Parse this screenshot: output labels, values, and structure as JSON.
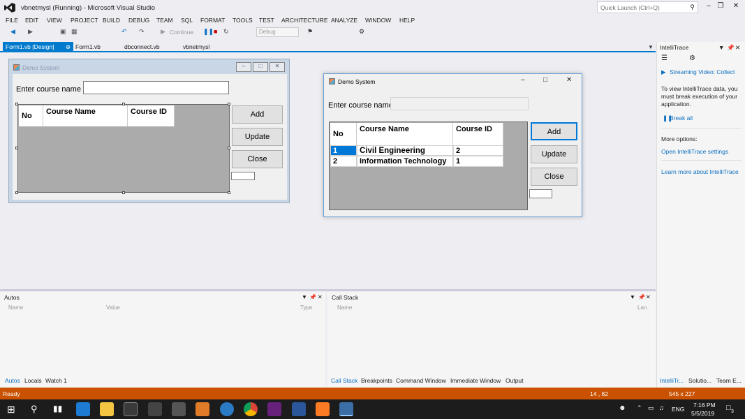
{
  "window": {
    "title": "vbnetmysl (Running) - Microsoft Visual Studio"
  },
  "quick_launch": {
    "placeholder": "Quick Launch (Ctrl+Q)"
  },
  "window_controls": {
    "minimize": "–",
    "restore": "❐",
    "close": "✕"
  },
  "menu": [
    "FILE",
    "EDIT",
    "VIEW",
    "PROJECT",
    "BUILD",
    "DEBUG",
    "TEAM",
    "SQL",
    "FORMAT",
    "TOOLS",
    "TEST",
    "ARCHITECTURE",
    "ANALYZE",
    "WINDOW",
    "HELP"
  ],
  "toolbar": {
    "continue_label": "Continue",
    "config": "Debug"
  },
  "doc_tabs": [
    {
      "label": "Form1.vb [Design]",
      "active": true
    },
    {
      "label": "Form1.vb"
    },
    {
      "label": "dbconnect.vb"
    },
    {
      "label": "vbnetmysl"
    }
  ],
  "design_form": {
    "title": "Demo System",
    "label": "Enter course name",
    "columns": [
      "No",
      "Course Name",
      "Course ID"
    ],
    "buttons": {
      "add": "Add",
      "update": "Update",
      "close": "Close"
    }
  },
  "run_form": {
    "title": "Demo System",
    "label": "Enter course name",
    "columns": [
      "No",
      "Course Name",
      "Course ID"
    ],
    "rows": [
      {
        "no": "1",
        "name": "Civil Engineering",
        "id": "2"
      },
      {
        "no": "2",
        "name": "Information Technology",
        "id": "1"
      }
    ],
    "buttons": {
      "add": "Add",
      "update": "Update",
      "close": "Close"
    }
  },
  "autos_panel": {
    "title": "Autos",
    "columns": [
      "Name",
      "Value",
      "Type"
    ],
    "tabs": [
      "Autos",
      "Locals",
      "Watch 1"
    ]
  },
  "callstack_panel": {
    "title": "Call Stack",
    "columns": [
      "Name",
      "Lan"
    ],
    "tabs": [
      "Call Stack",
      "Breakpoints",
      "Command Window",
      "Immediate Window",
      "Output"
    ]
  },
  "intellitrace": {
    "title": "IntelliTrace",
    "streaming": "Streaming Video: Collect",
    "message": "To view IntelliTrace data, you must break execution of your application.",
    "break_all": "Break all",
    "more_options": "More options:",
    "link_settings": "Open IntelliTrace settings",
    "link_learn": "Learn more about IntelliTrace",
    "bottom_tabs": [
      "IntelliTr...",
      "Solutio...",
      "Team E..."
    ]
  },
  "statusbar": {
    "status": "Ready",
    "position": "14 , 82",
    "size": "545 x 227"
  },
  "taskbar": {
    "time": "7:16 PM",
    "date": "5/5/2019",
    "lang": "ENG",
    "notif": "3"
  },
  "colors": {
    "accent": "#007acc",
    "status": "#ca5100",
    "taskbar": "#1c1c1c"
  }
}
